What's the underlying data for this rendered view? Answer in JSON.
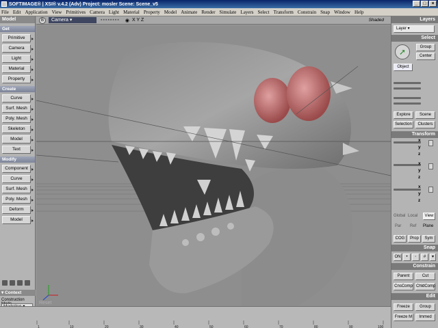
{
  "window": {
    "title": "SOFTIMAGE® | XSI® v.4.2 (Adv) Project: mosler    Scene: Scene_v5",
    "buttons": [
      "_",
      "□",
      "×"
    ]
  },
  "menu": [
    "File",
    "Edit",
    "Application",
    "View",
    "Primitives",
    "Camera",
    "Light",
    "Material",
    "Property",
    "Model",
    "Animate",
    "Render",
    "Simulate",
    "Layers",
    "Select",
    "Transform",
    "Constrain",
    "Snap",
    "Window",
    "Help"
  ],
  "left_panel": {
    "title": "Model",
    "sections": [
      {
        "title": "Get",
        "buttons": [
          "Primitive",
          "Camera",
          "Light",
          "Material",
          "Property"
        ]
      },
      {
        "title": "Create",
        "buttons": [
          "Curve",
          "Surf. Mesh",
          "Poly. Mesh",
          "Skeleton",
          "Model",
          "Text"
        ]
      },
      {
        "title": "Modify",
        "buttons": [
          "Component",
          "Curve",
          "Surf. Mesh",
          "Poly. Mesh",
          "Deform",
          "Model"
        ]
      }
    ],
    "context": {
      "title": "Context",
      "mode_label": "Construction Mode",
      "mode_value": "Modeling"
    }
  },
  "viewport": {
    "letter": "B",
    "camera": "Camera",
    "axis_label": "X Y Z",
    "shading": "Shaded",
    "reset_label": "Reset"
  },
  "timeline": {
    "ticks": [
      "1",
      "10",
      "20",
      "30",
      "40",
      "50",
      "60",
      "70",
      "80",
      "90",
      "100"
    ]
  },
  "right_panel": {
    "layers_title": "Layers",
    "layer_value": "Layer",
    "select_title": "Select",
    "select_buttons": [
      "Group",
      "Center"
    ],
    "object_label": "Object",
    "explore_buttons": [
      "Explore",
      "Scene",
      "Selection",
      "Clusters"
    ],
    "transform_title": "Transform",
    "axes": [
      "x",
      "y",
      "z"
    ],
    "mode_labels": [
      "Global",
      "Local",
      "View",
      "Par",
      "Ref",
      "Plane"
    ],
    "cog_buttons": [
      "COG",
      "Prop",
      "Sym"
    ],
    "snap_title": "Snap",
    "snap_on": "ON",
    "constrain_title": "Constrain",
    "constrain_buttons": [
      "Parent",
      "Cut",
      "CnsComp",
      "ChldComp"
    ],
    "edit_title": "Edit",
    "edit_buttons": [
      "Freeze",
      "Group",
      "Freeze M",
      "Immed"
    ]
  }
}
